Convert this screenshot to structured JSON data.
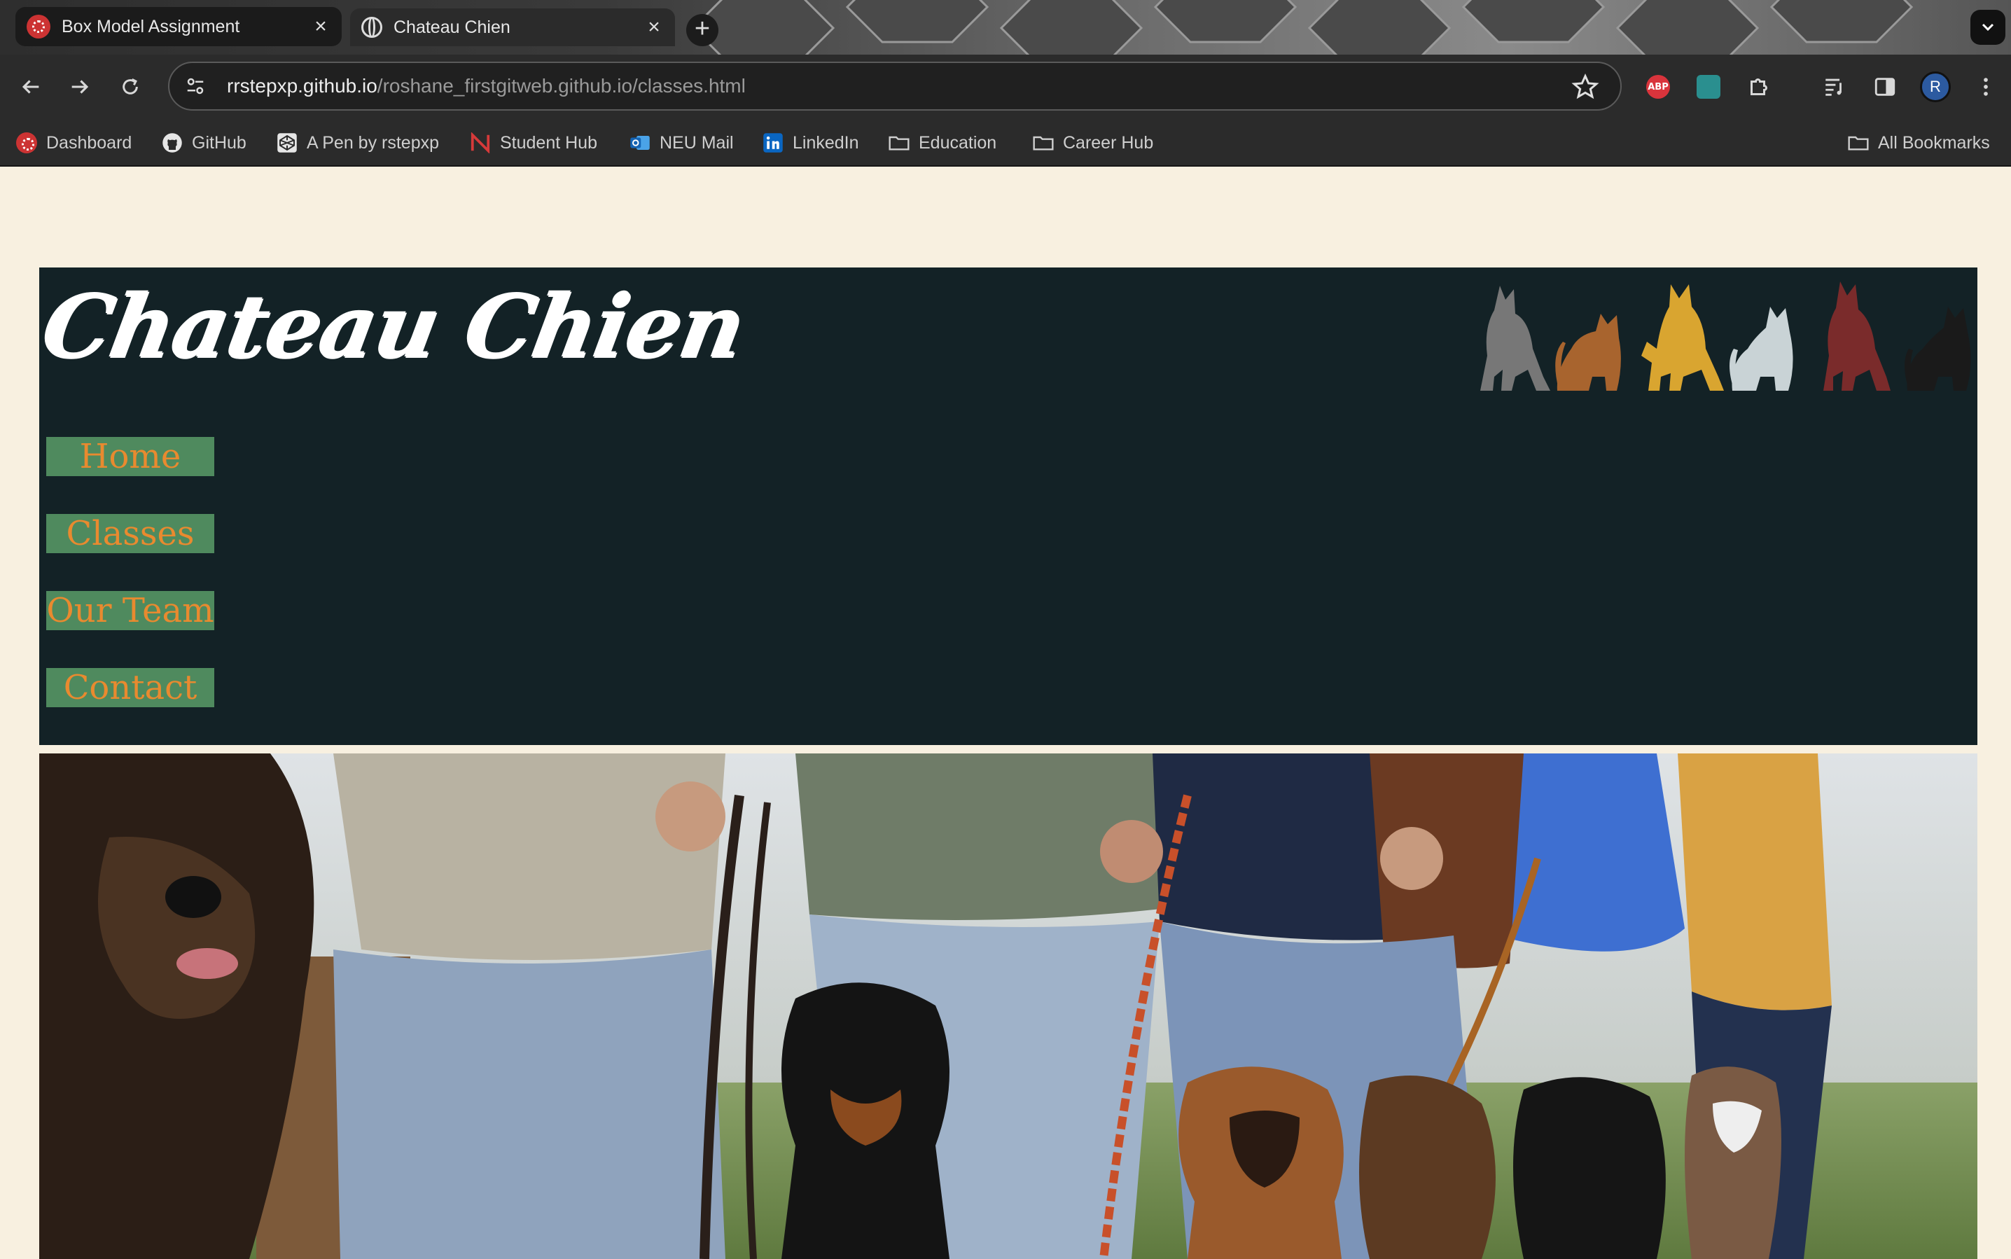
{
  "browser": {
    "tabs": [
      {
        "title": "Box Model Assignment",
        "favicon": "dashboard-icon",
        "active": false
      },
      {
        "title": "Chateau Chien",
        "favicon": "globe-icon",
        "active": true
      }
    ],
    "url_host": "rrstepxp.github.io",
    "url_path": "/roshane_firstgitweb.github.io/classes.html",
    "profile_initial": "R",
    "extensions": [
      "adblock-plus-icon",
      "amazon-assistant-icon",
      "extensions-puzzle-icon",
      "media-control-icon",
      "side-panel-icon"
    ],
    "bookmarks": [
      {
        "label": "Dashboard",
        "icon": "dashboard-icon"
      },
      {
        "label": "GitHub",
        "icon": "github-icon"
      },
      {
        "label": "A Pen by rstepxp",
        "icon": "codepen-icon"
      },
      {
        "label": "Student Hub",
        "icon": "northeastern-icon"
      },
      {
        "label": "NEU Mail",
        "icon": "outlook-icon"
      },
      {
        "label": "LinkedIn",
        "icon": "linkedin-icon"
      },
      {
        "label": "Education",
        "icon": "folder-icon"
      },
      {
        "label": "Career Hub",
        "icon": "folder-icon"
      }
    ],
    "all_bookmarks": "All Bookmarks",
    "abp_label": "ABP"
  },
  "site": {
    "logo": "Chateau Chien",
    "nav": [
      "Home",
      "Classes",
      "Our Team",
      "Contact"
    ],
    "colors": {
      "header_bg": "#132226",
      "nav_bg": "#4f8a5e",
      "nav_text": "#e98a2f",
      "page_bg": "#f8f0e0"
    },
    "hero_image": "people-with-dogs-on-leashes-photo"
  }
}
